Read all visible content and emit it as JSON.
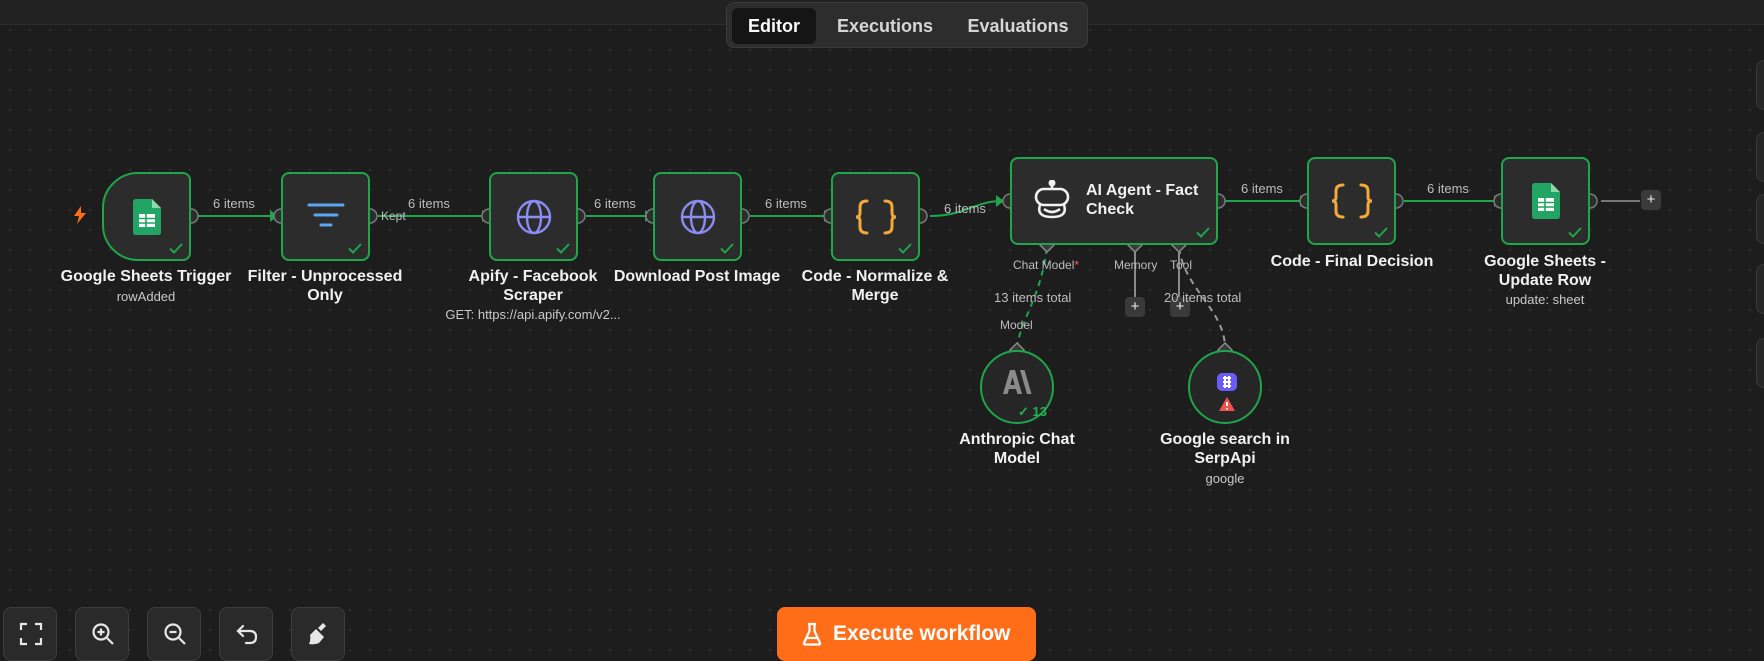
{
  "tabs": {
    "editor": "Editor",
    "executions": "Executions",
    "evaluations": "Evaluations"
  },
  "edges": {
    "e1": "6 items",
    "e2_out": "Kept",
    "e2": "6 items",
    "e3": "6 items",
    "e4": "6 items",
    "e5": "6 items",
    "e6": "6 items",
    "e7": "6 items",
    "chat_total": "13 items total",
    "tool_total": "20 items total"
  },
  "nodes": {
    "trigger": {
      "label": "Google Sheets Trigger",
      "sub": "rowAdded",
      "icon": "google-sheets-icon"
    },
    "filter": {
      "label": "Filter - Unprocessed Only",
      "icon": "filter-icon"
    },
    "apify": {
      "label": "Apify - Facebook Scraper",
      "sub": "GET: https://api.apify.com/v2...",
      "icon": "globe-icon"
    },
    "download": {
      "label": "Download Post Image",
      "icon": "globe-icon"
    },
    "normalize": {
      "label": "Code - Normalize & Merge",
      "icon": "code-braces-icon"
    },
    "agent": {
      "label": "AI Agent - Fact Check",
      "icon": "robot-icon",
      "ports": {
        "chat": "Chat Model",
        "chat_required": "*",
        "memory": "Memory",
        "tool": "Tool"
      }
    },
    "final": {
      "label": "Code - Final Decision",
      "icon": "code-braces-icon"
    },
    "update": {
      "label": "Google Sheets - Update Row",
      "sub": "update: sheet",
      "icon": "google-sheets-icon"
    },
    "anthropic": {
      "label": "Anthropic Chat Model",
      "port": "Model",
      "badge": "13",
      "icon": "anthropic-icon"
    },
    "serp": {
      "label": "Google search in SerpApi",
      "sub": "google",
      "icon": "serpapi-icon"
    }
  },
  "toolbar": {
    "exec_label": "Execute workflow"
  },
  "colors": {
    "success": "#1fa54b",
    "accent": "#ff6d19",
    "sheets": "#21a464",
    "code": "#f2a83b",
    "http": "#8b8cf4"
  }
}
